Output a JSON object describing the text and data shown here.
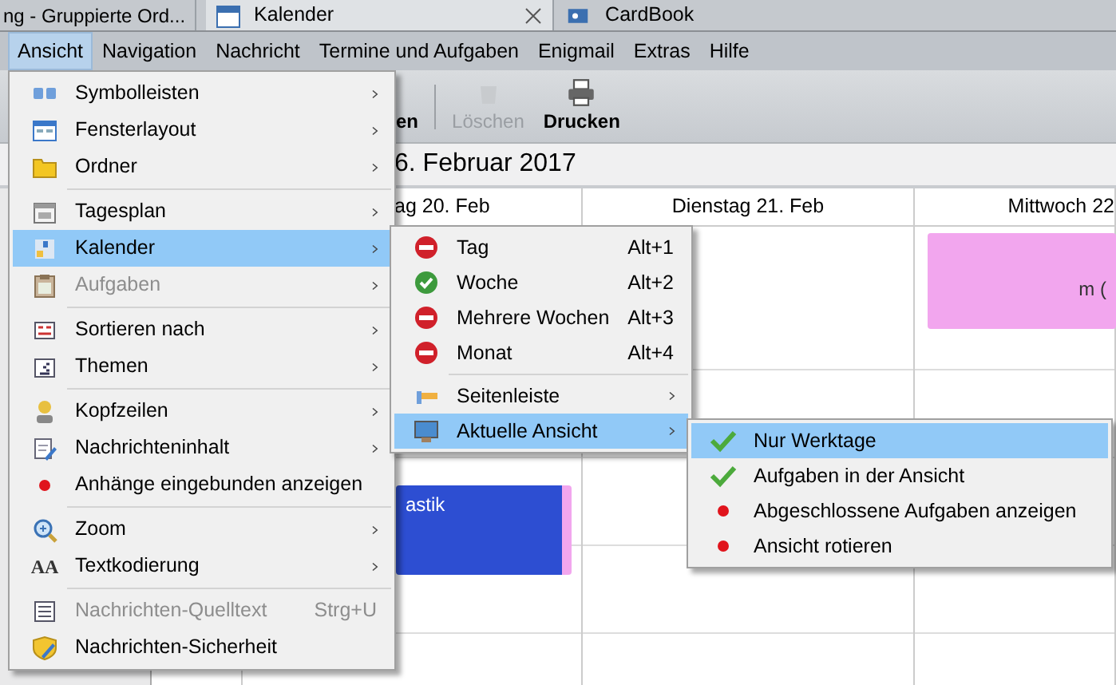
{
  "tabs": [
    {
      "label": "ng - Gruppierte Ord...",
      "selected": false
    },
    {
      "label": "Kalender",
      "selected": true
    },
    {
      "label": "CardBook",
      "selected": false
    }
  ],
  "menubar": [
    {
      "label": "Ansicht",
      "selected": true
    },
    {
      "label": "Navigation",
      "selected": false
    },
    {
      "label": "Nachricht",
      "selected": false
    },
    {
      "label": "Termine und Aufgaben",
      "selected": false
    },
    {
      "label": "Enigmail",
      "selected": false
    },
    {
      "label": "Extras",
      "selected": false
    },
    {
      "label": "Hilfe",
      "selected": false
    }
  ],
  "toolbar": [
    {
      "label": "en",
      "disabled": false
    },
    {
      "label": "Löschen",
      "disabled": true
    },
    {
      "label": "Drucken",
      "disabled": false
    }
  ],
  "calendar": {
    "title": "6. Februar 2017",
    "days": [
      {
        "label": "ag 20. Feb",
        "events": [
          {
            "title": "astik",
            "color": "#2d4ed2"
          }
        ]
      },
      {
        "label": "Dienstag 21. Feb"
      },
      {
        "label": "Mittwoch 22",
        "events": [
          {
            "title": "m (",
            "color": "#f2a6ee"
          }
        ]
      }
    ]
  },
  "view_menu": {
    "items": [
      {
        "kind": "submenu",
        "label": "Symbolleisten",
        "selected": false,
        "disabled": false
      },
      {
        "kind": "submenu",
        "label": "Fensterlayout",
        "selected": false,
        "disabled": false
      },
      {
        "kind": "submenu",
        "label": "Ordner",
        "selected": false,
        "disabled": false
      },
      {
        "kind": "separator"
      },
      {
        "kind": "submenu",
        "label": "Tagesplan",
        "selected": false,
        "disabled": false
      },
      {
        "kind": "submenu",
        "label": "Kalender",
        "selected": true,
        "disabled": false
      },
      {
        "kind": "submenu",
        "label": "Aufgaben",
        "selected": false,
        "disabled": true
      },
      {
        "kind": "separator"
      },
      {
        "kind": "submenu",
        "label": "Sortieren nach",
        "selected": false,
        "disabled": false
      },
      {
        "kind": "submenu",
        "label": "Themen",
        "selected": false,
        "disabled": false
      },
      {
        "kind": "separator"
      },
      {
        "kind": "submenu",
        "label": "Kopfzeilen",
        "selected": false,
        "disabled": false
      },
      {
        "kind": "submenu",
        "label": "Nachrichteninhalt",
        "selected": false,
        "disabled": false
      },
      {
        "kind": "checkbox",
        "label": "Anhänge eingebunden anzeigen",
        "selected": false,
        "disabled": false,
        "checked": false
      },
      {
        "kind": "separator"
      },
      {
        "kind": "submenu",
        "label": "Zoom",
        "selected": false,
        "disabled": false
      },
      {
        "kind": "submenu",
        "label": "Textkodierung",
        "selected": false,
        "disabled": false,
        "icon_text": "AA"
      },
      {
        "kind": "separator"
      },
      {
        "kind": "command",
        "label": "Nachrichten-Quelltext",
        "selected": false,
        "disabled": true,
        "shortcut": "Strg+U"
      },
      {
        "kind": "command",
        "label": "Nachrichten-Sicherheit",
        "selected": false,
        "disabled": false
      }
    ]
  },
  "calendar_menu": {
    "items": [
      {
        "kind": "radio",
        "label": "Tag",
        "selected": false,
        "disabled": false,
        "checked": false,
        "shortcut": "Alt+1"
      },
      {
        "kind": "radio",
        "label": "Woche",
        "selected": false,
        "disabled": false,
        "checked": true,
        "shortcut": "Alt+2"
      },
      {
        "kind": "radio",
        "label": "Mehrere Wochen",
        "selected": false,
        "disabled": false,
        "checked": false,
        "shortcut": "Alt+3"
      },
      {
        "kind": "radio",
        "label": "Monat",
        "selected": false,
        "disabled": false,
        "checked": false,
        "shortcut": "Alt+4"
      },
      {
        "kind": "separator"
      },
      {
        "kind": "submenu",
        "label": "Seitenleiste",
        "selected": false,
        "disabled": false
      },
      {
        "kind": "submenu",
        "label": "Aktuelle Ansicht",
        "selected": true,
        "disabled": false
      }
    ]
  },
  "current_view_menu": {
    "items": [
      {
        "kind": "checkbox",
        "label": "Nur Werktage",
        "selected": true,
        "disabled": false,
        "checked": true
      },
      {
        "kind": "checkbox",
        "label": "Aufgaben in der Ansicht",
        "selected": false,
        "disabled": false,
        "checked": true
      },
      {
        "kind": "checkbox",
        "label": "Abgeschlossene Aufgaben anzeigen",
        "selected": false,
        "disabled": false,
        "checked": false
      },
      {
        "kind": "checkbox",
        "label": "Ansicht rotieren",
        "selected": false,
        "disabled": false,
        "checked": false
      }
    ]
  }
}
